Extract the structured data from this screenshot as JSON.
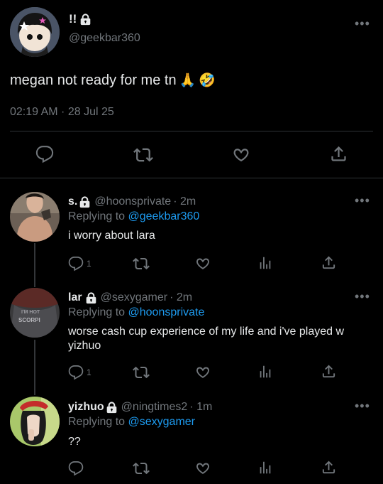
{
  "main": {
    "display_name": "!!",
    "handle": "@geekbar360",
    "text": "megan not ready for me tn",
    "emojis": [
      "🙏",
      "🤣"
    ],
    "timestamp": "02:19 AM · 28 Jul 25",
    "icons": [
      "reply-icon",
      "retweet-icon",
      "like-icon",
      "share-icon"
    ]
  },
  "replies": [
    {
      "display_name": "s.",
      "handle": "@hoonsprivate",
      "time": "· 2m",
      "replying_label": "Replying to",
      "replying_to": "@geekbar360",
      "text": "i worry about lara",
      "reply_count": "1"
    },
    {
      "display_name": "lar",
      "handle": "@sexygamer",
      "time": "· 2m",
      "replying_label": "Replying to",
      "replying_to": "@hoonsprivate",
      "text": "worse cash cup experience of my life and i've played w yizhuo",
      "reply_count": "1"
    },
    {
      "display_name": "yizhuo",
      "handle": "@ningtimes2",
      "time": "· 1m",
      "replying_label": "Replying to",
      "replying_to": "@sexygamer",
      "text": "??",
      "reply_count": ""
    }
  ],
  "colors": {
    "background": "#000000",
    "text": "#e7e9ea",
    "muted": "#71767b",
    "link": "#1d9bf0",
    "divider": "#2f3336"
  }
}
